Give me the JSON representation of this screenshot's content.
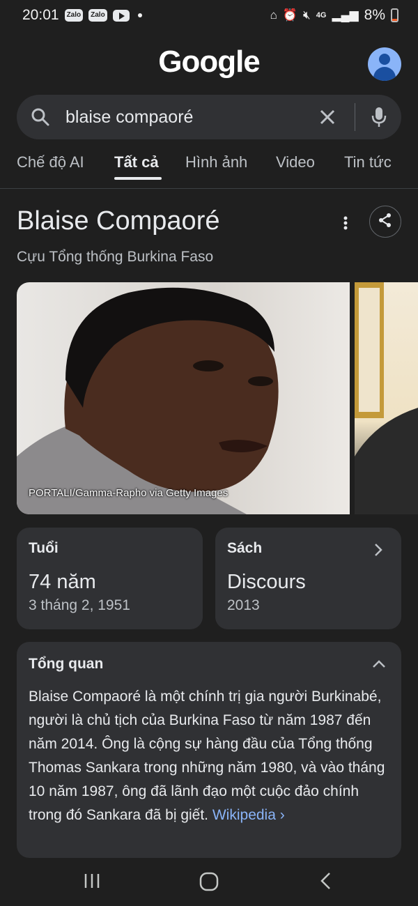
{
  "status_bar": {
    "time": "20:01",
    "app_badges": [
      "Zalo",
      "Zalo"
    ],
    "network": "4G",
    "battery": "8%"
  },
  "header": {
    "logo": "Google"
  },
  "search": {
    "query": "blaise compaoré"
  },
  "tabs": [
    {
      "label": "Chế độ AI",
      "active": false
    },
    {
      "label": "Tất cả",
      "active": true
    },
    {
      "label": "Hình ảnh",
      "active": false
    },
    {
      "label": "Video",
      "active": false
    },
    {
      "label": "Tin tức",
      "active": false
    }
  ],
  "knowledge_panel": {
    "title": "Blaise Compaoré",
    "subtitle": "Cựu Tổng thống Burkina Faso",
    "photo_credit": "PORTALI/Gamma-Rapho via Getty Images",
    "cards": [
      {
        "label": "Tuổi",
        "value": "74 năm",
        "sub": "3 tháng 2, 1951"
      },
      {
        "label": "Sách",
        "value": "Discours",
        "sub": "2013"
      }
    ],
    "overview": {
      "title": "Tổng quan",
      "text": "Blaise Compaoré là một chính trị gia người Burkinabé, người là chủ tịch của Burkina Faso từ năm 1987 đến năm 2014. Ông là cộng sự hàng đầu của Tổng thống Thomas Sankara trong những năm 1980, và vào tháng 10 năm 1987, ông đã lãnh đạo một cuộc đảo chính trong đó Sankara đã bị giết.",
      "link": "Wikipedia ›"
    }
  },
  "colors": {
    "background": "#1f1f1f",
    "surface": "#303134",
    "link": "#8ab4f8",
    "battery_low": "#ef5b25"
  }
}
